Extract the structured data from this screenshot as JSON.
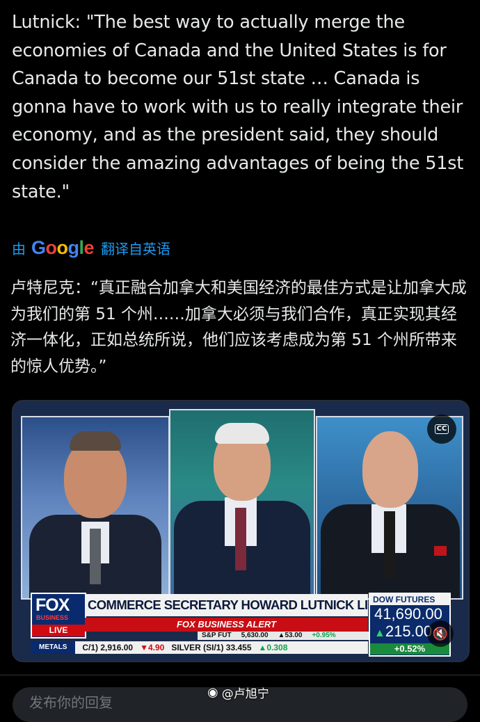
{
  "tweet": {
    "text": "Lutnick: \"The best way to actually merge the economies of Canada and the United States is for Canada to become our 51st state … Canada is gonna have to work with us to really integrate their economy, and as the president said, they should consider the amazing advantages of being the 51st state.\""
  },
  "translation": {
    "by": "由",
    "provider": "Google",
    "label": "翻译自英语",
    "text": "卢特尼克：“真正融合加拿大和美国经济的最佳方式是让加拿大成为我们的第 51 个州……加拿大必须与我们合作，真正实现其经济一体化，正如总统所说，他们应该考虑成为第 51 个州所带来的惊人优势。”"
  },
  "media": {
    "cc_label": "CC",
    "network_logo": "FOX",
    "network_sub": "BUSINESS",
    "live_label": "LIVE",
    "headline": "COMMERCE SECRETARY HOWARD LUTNICK LIVE ON VARNEY",
    "alert": "FOX BUSINESS ALERT",
    "sp_row": [
      "S&P FUT",
      "5,630.00",
      "▲53.00",
      "+0.95%"
    ],
    "metals_label": "METALS",
    "metals_items": [
      "C/1) 2,916.00",
      "▼4.90",
      "SILVER (SI/1) 33.455",
      "▲0.308"
    ],
    "dow_title": "DOW FUTURES",
    "dow_value": "41,690.00",
    "dow_change": "215.00",
    "dow_pct": "+0.52%"
  },
  "reply": {
    "placeholder": "发布你的回复"
  },
  "watermark": {
    "text": "@卢旭宁"
  }
}
